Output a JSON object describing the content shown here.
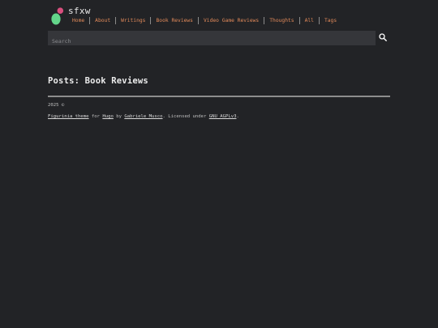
{
  "site": {
    "title": "sfxw"
  },
  "nav": {
    "items": [
      {
        "label": "Home"
      },
      {
        "label": "About"
      },
      {
        "label": "Writings"
      },
      {
        "label": "Book Reviews"
      },
      {
        "label": "Video Game Reviews"
      },
      {
        "label": "Thoughts"
      },
      {
        "label": "All"
      },
      {
        "label": "Tags"
      }
    ]
  },
  "search": {
    "placeholder": "Search",
    "icon": "search-icon"
  },
  "main": {
    "title": "Posts: Book Reviews"
  },
  "footer": {
    "copyright": "2025 ©",
    "theme_link": "Figurinia theme",
    "for_text": " for ",
    "hugo_link": "Hugo",
    "by_text": " by ",
    "author_link": "Gabriele Musco",
    "licensed_text": ". Licensed under ",
    "license_link": "GNU AGPLv3",
    "end_text": "."
  },
  "colors": {
    "background": "#222326",
    "nav_link": "#e28a5a",
    "logo_pink": "#d94f7e",
    "logo_green": "#63d58a"
  }
}
